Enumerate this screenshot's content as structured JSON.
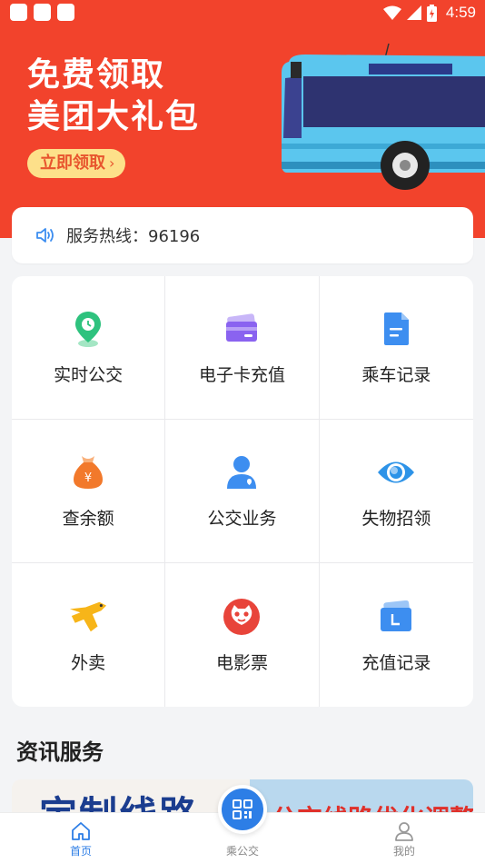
{
  "status_bar": {
    "time": "4:59"
  },
  "promo": {
    "title_line1": "免费领取",
    "title_line2": "美团大礼包",
    "button_label": "立即领取",
    "button_chevron": "›"
  },
  "hotline": {
    "text": "服务热线：96196"
  },
  "services": [
    {
      "label": "实时公交",
      "icon": "bus-location-icon",
      "color": "#2ec27e"
    },
    {
      "label": "电子卡充值",
      "icon": "card-icon",
      "color": "#8a63f0"
    },
    {
      "label": "乘车记录",
      "icon": "document-icon",
      "color": "#3d8ef0"
    },
    {
      "label": "查余额",
      "icon": "money-bag-icon",
      "color": "#f2792b"
    },
    {
      "label": "公交业务",
      "icon": "person-icon",
      "color": "#3d8ef0"
    },
    {
      "label": "失物招领",
      "icon": "eye-icon",
      "color": "#2d93e8"
    },
    {
      "label": "外卖",
      "icon": "kangaroo-icon",
      "color": "#f7b519"
    },
    {
      "label": "电影票",
      "icon": "cat-icon",
      "color": "#e8443a"
    },
    {
      "label": "充值记录",
      "icon": "recharge-record-icon",
      "color": "#3d8ef0"
    }
  ],
  "section": {
    "title": "资讯服务"
  },
  "news": {
    "left_text": "定制线路",
    "right_text": "公交线路优化调整"
  },
  "tabbar": {
    "home": "首页",
    "ride": "乘公交",
    "mine": "我的",
    "active_color": "#2d7ee6"
  }
}
